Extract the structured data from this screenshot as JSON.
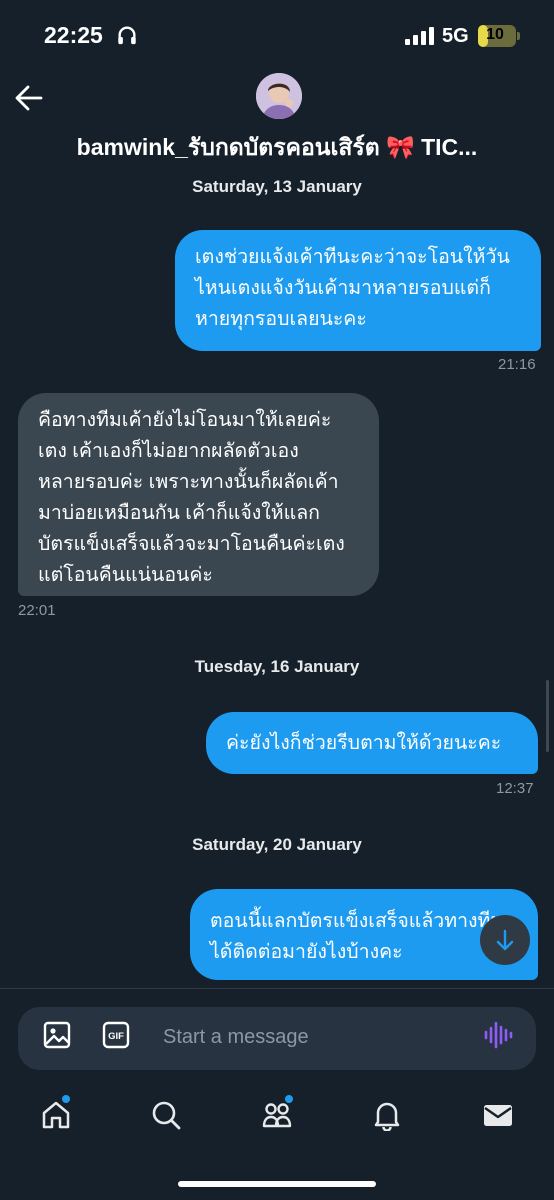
{
  "status_bar": {
    "time": "22:25",
    "network": "5G",
    "battery": "10",
    "battery_level": 0.25
  },
  "header": {
    "title": "bamwink_รับกดบัตรคอนเสิร์ต 🎀 TIC..."
  },
  "messages": [
    {
      "type": "date",
      "label": "Saturday, 13 January"
    },
    {
      "type": "out",
      "text": "เตงช่วยแจ้งเค้าทีนะคะว่าจะโอนให้วัน\nไหนเตงแจ้งวันเค้ามาหลายรอบแต่ก็\nหายทุกรอบเลยนะคะ",
      "time": "21:16"
    },
    {
      "type": "in",
      "text": "คือทางทีมเค้ายังไม่โอนมาให้เลยค่ะ\nเตง เค้าเองก็ไม่อยากผลัดตัวเอง\nหลายรอบค่ะ เพราะทางนั้นก็ผลัดเค้า\nมาบ่อยเหมือนกัน เค้าก็แจ้งให้แลก\nบัตรแข็งเสร็จแล้วจะมาโอนคืนค่ะเตง\nแต่โอนคืนแน่นอนค่ะ",
      "time": "22:01"
    },
    {
      "type": "date",
      "label": "Tuesday, 16 January"
    },
    {
      "type": "out",
      "text": "ค่ะยังไงก็ช่วยรีบตามให้ด้วยนะคะ",
      "time": "12:37"
    },
    {
      "type": "date",
      "label": "Saturday, 20 January"
    },
    {
      "type": "out",
      "text": "ตอนนี้แลกบัตรแข็งเสร็จแล้วทางทีม\nได้ติดต่อมายังไงบ้างคะ"
    }
  ],
  "composer": {
    "placeholder": "Start a message"
  },
  "nav": [
    "home-icon",
    "search-icon",
    "communities-icon",
    "notifications-icon",
    "messages-icon"
  ],
  "colors": {
    "background": "#15202b",
    "accent": "#1d9bf0",
    "incoming": "#3a4650",
    "muted": "#8b98a5"
  }
}
